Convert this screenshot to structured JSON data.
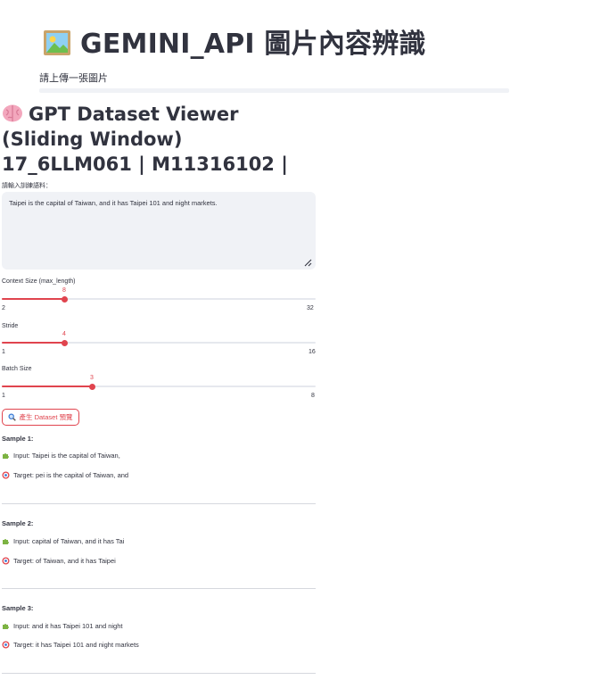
{
  "header": {
    "title": "GEMINI_API 圖片內容辨識",
    "title_icon": "framed-picture-icon"
  },
  "uploader": {
    "label": "請上傳一張圖片"
  },
  "viewer": {
    "title": "GPT Dataset Viewer (Sliding Window) 17_6LLM061 | M11316102 |",
    "title_icon": "brain-icon"
  },
  "text_input": {
    "label": "請輸入訓練語料：",
    "value": "Taipei is the capital of Taiwan, and it has Taipei 101 and night markets."
  },
  "sliders": [
    {
      "label": "Context Size (max_length)",
      "value": "8",
      "min": "2",
      "max": "32",
      "fraction": 0.2
    },
    {
      "label": "Stride",
      "value": "4",
      "min": "1",
      "max": "16",
      "fraction": 0.2
    },
    {
      "label": "Batch Size",
      "value": "3",
      "min": "1",
      "max": "8",
      "fraction": 0.2857
    }
  ],
  "generate_button": {
    "label": "產生 Dataset 預覽",
    "icon": "magnifier-icon"
  },
  "samples": [
    {
      "title": "Sample 1:",
      "input": "Input: Taipei is the capital of Taiwan,",
      "target": "Target: pei is the capital of Taiwan, and"
    },
    {
      "title": "Sample 2:",
      "input": "Input: capital of Taiwan, and it has Tai",
      "target": "Target: of Taiwan, and it has Taipei"
    },
    {
      "title": "Sample 3:",
      "input": "Input: and it has Taipei 101 and night",
      "target": "Target: it has Taipei 101 and night markets"
    }
  ],
  "colors": {
    "accent": "#e0444e",
    "text": "#31333f",
    "input_bg": "#f0f2f6"
  }
}
